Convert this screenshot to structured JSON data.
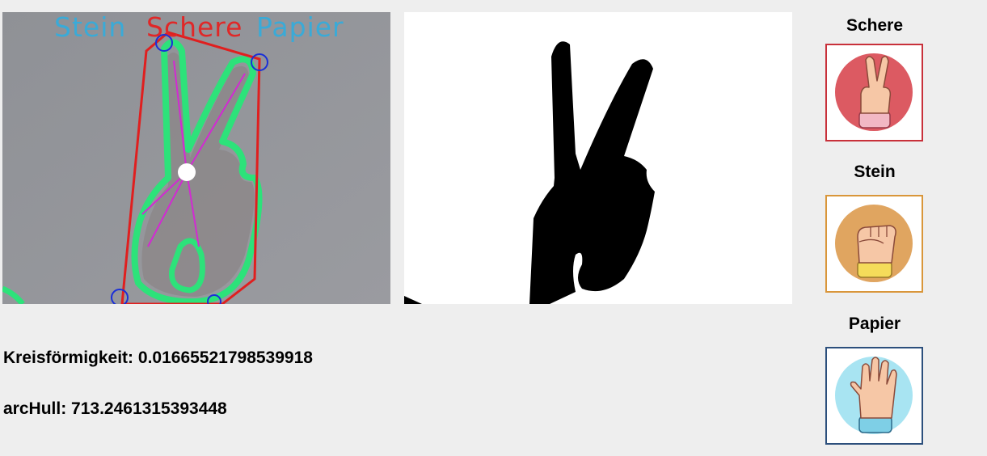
{
  "camera": {
    "overlay_labels": [
      {
        "text": "Stein",
        "color": "#3aaad7"
      },
      {
        "text": "Schere",
        "color": "#e02828"
      },
      {
        "text": "Papier",
        "color": "#3aaad7"
      }
    ]
  },
  "stats": {
    "circularity_label": "Kreisförmigkeit:",
    "circularity_value": "0.01665521798539918",
    "archull_label": "arcHull:",
    "archull_value": "713.2461315393448"
  },
  "choices": [
    {
      "label": "Schere",
      "icon": "scissors-hand-icon",
      "border_color": "#c8303a",
      "circle_color": "#dc5a62"
    },
    {
      "label": "Stein",
      "icon": "fist-hand-icon",
      "border_color": "#d9963a",
      "circle_color": "#e0a560"
    },
    {
      "label": "Papier",
      "icon": "open-hand-icon",
      "border_color": "#2c4f7c",
      "circle_color": "#a8e4f2"
    }
  ]
}
